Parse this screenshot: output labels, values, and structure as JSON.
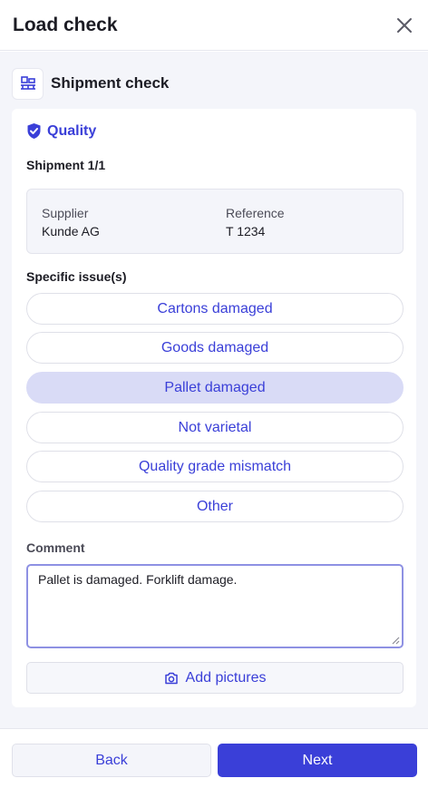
{
  "header": {
    "title": "Load check",
    "close_icon": "close-icon"
  },
  "section": {
    "title": "Shipment check",
    "icon": "pallet-icon"
  },
  "quality": {
    "label": "Quality",
    "icon": "shield-check-icon"
  },
  "shipment": {
    "label": "Shipment 1/1",
    "supplier_key": "Supplier",
    "supplier_value": "Kunde AG",
    "reference_key": "Reference",
    "reference_value": "T 1234"
  },
  "issues": {
    "label": "Specific issue(s)",
    "options": [
      {
        "label": "Cartons damaged",
        "selected": false
      },
      {
        "label": "Goods damaged",
        "selected": false
      },
      {
        "label": "Pallet damaged",
        "selected": true
      },
      {
        "label": "Not varietal",
        "selected": false
      },
      {
        "label": "Quality grade mismatch",
        "selected": false
      },
      {
        "label": "Other",
        "selected": false
      }
    ]
  },
  "comment": {
    "label": "Comment",
    "value": "Pallet is damaged. Forklift damage."
  },
  "pictures": {
    "label": "Add pictures",
    "icon": "camera-icon"
  },
  "footer": {
    "back_label": "Back",
    "next_label": "Next"
  },
  "colors": {
    "accent": "#3a3fd8",
    "selected_bg": "#d9dbf6",
    "panel_bg": "#f4f5fa"
  }
}
